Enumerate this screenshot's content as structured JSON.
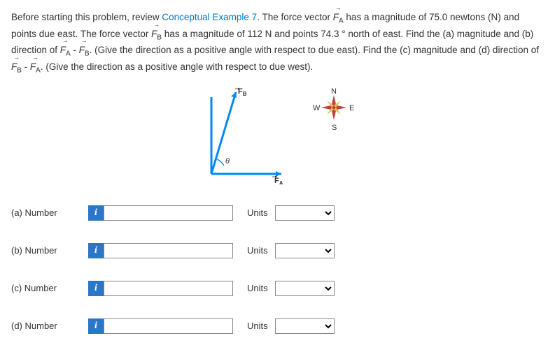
{
  "problem": {
    "text_parts": {
      "p1": "Before starting this problem, review ",
      "link": "Conceptual Example 7",
      "p2": ". The force vector ",
      "p3": " has a magnitude of 75.0 newtons (N) and points due east. The force vector ",
      "p4": " has a magnitude of 112 N and points 74.3 ° north of east. Find the (a) magnitude and (b) direction of ",
      "p5": ". (Give the direction as a positive angle with respect to due east). Find the (c) magnitude and (d) direction of ",
      "p6": ". (Give the direction as a positive angle with respect to due west)."
    },
    "vec_FA": "F",
    "sub_A": "A",
    "vec_FB": "F",
    "sub_B": "B",
    "minus": " - "
  },
  "diagram": {
    "fb_label": "F",
    "fb_sub": "B",
    "fa_label": "F",
    "fa_sub": "A",
    "theta": "θ",
    "compass": {
      "n": "N",
      "s": "S",
      "e": "E",
      "w": "W"
    }
  },
  "answers": {
    "units_label": "Units",
    "info_glyph": "i",
    "rows": [
      {
        "label": "(a)   Number"
      },
      {
        "label": "(b)   Number"
      },
      {
        "label": "(c)   Number"
      },
      {
        "label": "(d)   Number"
      }
    ]
  }
}
